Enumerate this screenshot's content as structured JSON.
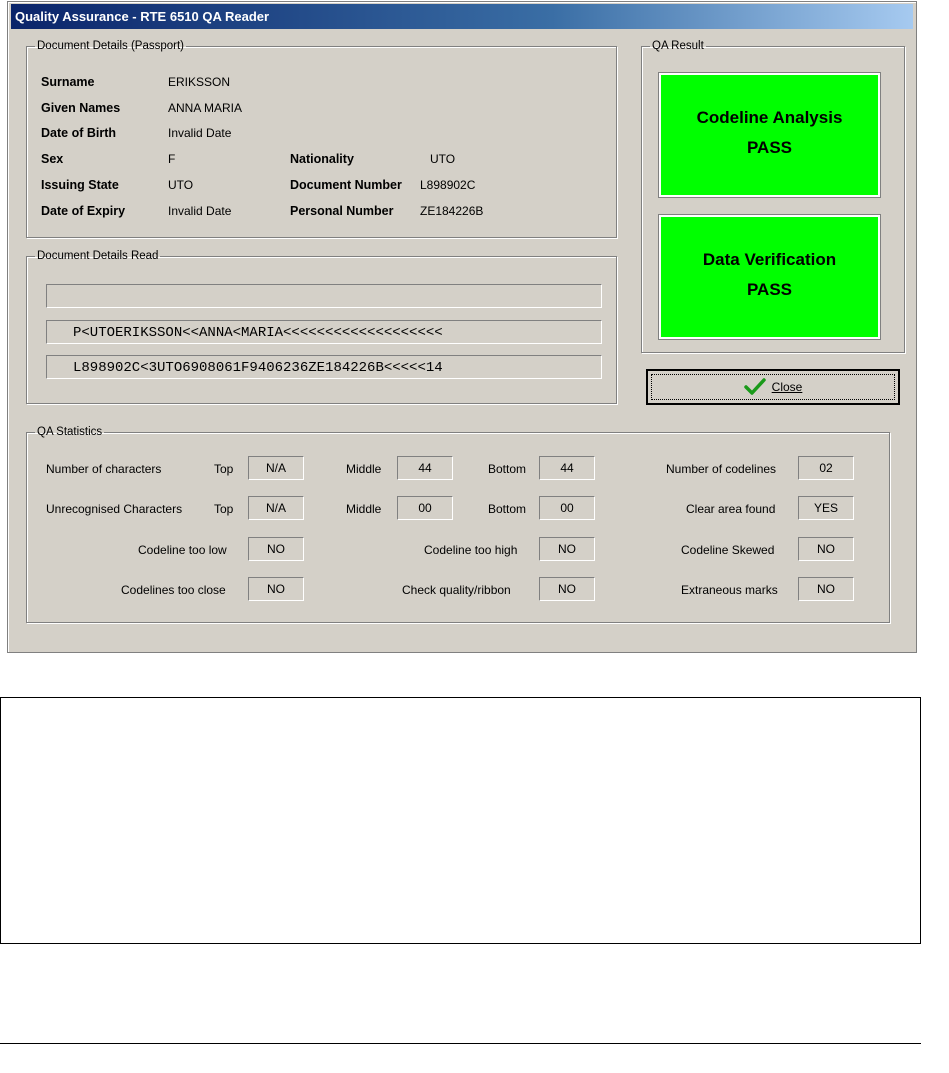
{
  "window": {
    "title": "Quality Assurance - RTE 6510 QA Reader"
  },
  "doc_details": {
    "legend": "Document Details (Passport)",
    "surname_label": "Surname",
    "surname": "ERIKSSON",
    "given_label": "Given Names",
    "given": "ANNA MARIA",
    "dob_label": "Date of Birth",
    "dob": "Invalid Date",
    "sex_label": "Sex",
    "sex": "F",
    "issuing_label": "Issuing State",
    "issuing": "UTO",
    "expiry_label": "Date of Expiry",
    "expiry": "Invalid Date",
    "nationality_label": "Nationality",
    "nationality": "UTO",
    "docnum_label": "Document Number",
    "docnum": "L898902C",
    "personal_label": "Personal Number",
    "personal": "ZE184226B"
  },
  "read": {
    "legend": "Document Details Read",
    "line1": "",
    "line2": "P<UTOERIKSSON<<ANNA<MARIA<<<<<<<<<<<<<<<<<<<",
    "line3": "L898902C<3UTO6908061F9406236ZE184226B<<<<<14"
  },
  "qa_result": {
    "legend": "QA Result",
    "codeline_title": "Codeline Analysis",
    "codeline_status": "PASS",
    "verify_title": "Data Verification",
    "verify_status": "PASS",
    "pass_color": "#00ff00"
  },
  "close_button": {
    "label": "Close",
    "icon": "checkmark-icon"
  },
  "stats": {
    "legend": "QA Statistics",
    "num_chars_label": "Number of characters",
    "unrec_label": "Unrecognised Characters",
    "top_label": "Top",
    "middle_label": "Middle",
    "bottom_label": "Bottom",
    "num_top": "N/A",
    "num_middle": "44",
    "num_bottom": "44",
    "unrec_top": "N/A",
    "unrec_middle": "00",
    "unrec_bottom": "00",
    "codelines_label": "Number of codelines",
    "codelines": "02",
    "clear_label": "Clear area found",
    "clear": "YES",
    "low_label": "Codeline too low",
    "low": "NO",
    "high_label": "Codeline too high",
    "high": "NO",
    "skew_label": "Codeline Skewed",
    "skew": "NO",
    "close_label": "Codelines too close",
    "close": "NO",
    "quality_label": "Check quality/ribbon",
    "quality": "NO",
    "extra_label": "Extraneous marks",
    "extra": "NO"
  }
}
